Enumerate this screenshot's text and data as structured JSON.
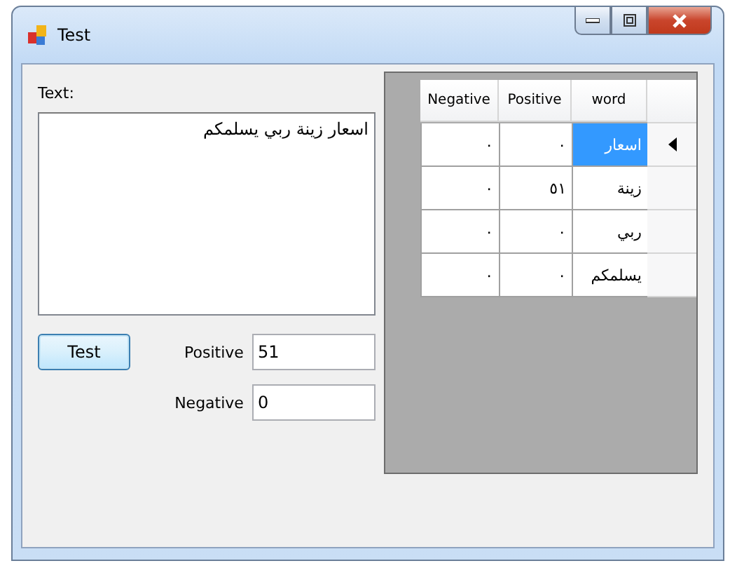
{
  "window": {
    "title": "Test"
  },
  "text_label": "Text:",
  "text_area": {
    "value": "اسعار زينة ربي يسلمكم"
  },
  "test_button": "Test",
  "fields": [
    {
      "label": "Positive",
      "value": "51"
    },
    {
      "label": "Negative",
      "value": "0"
    }
  ],
  "table": {
    "columns": [
      "word",
      "Positive",
      "Negative"
    ],
    "rows": [
      {
        "cells": [
          "اسعار",
          "٠",
          "٠"
        ],
        "selected": true
      },
      {
        "cells": [
          "زينة",
          "٥١",
          "٠"
        ],
        "selected": false
      },
      {
        "cells": [
          "ربي",
          "٠",
          "٠"
        ],
        "selected": false
      },
      {
        "cells": [
          "يسلمكم",
          "٠",
          "٠"
        ],
        "selected": false
      }
    ]
  }
}
